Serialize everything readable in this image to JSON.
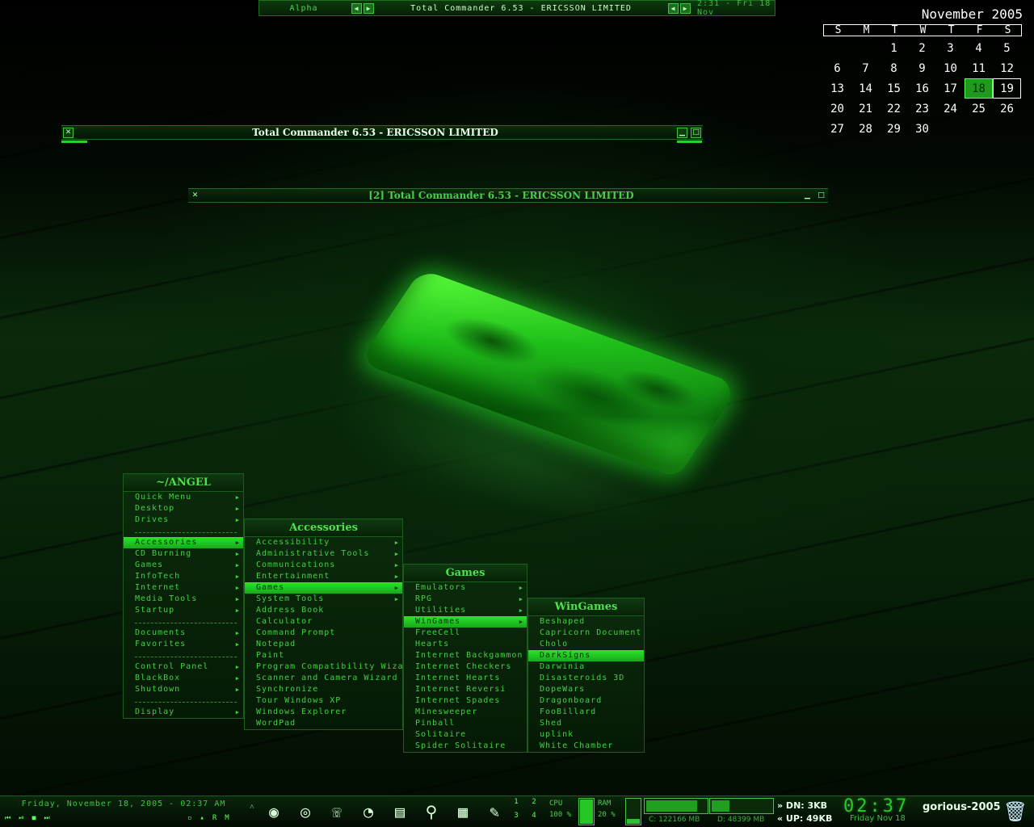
{
  "topbar": {
    "workspace": "Alpha",
    "title": "Total Commander 6.53 - ERICSSON LIMITED",
    "clock": "2:31 - Fri 18 Nov",
    "prev_icon": "arrow-left-icon",
    "next_icon": "arrow-right-icon"
  },
  "calendar": {
    "title": "November 2005",
    "weekdays": [
      "S",
      "M",
      "T",
      "W",
      "T",
      "F",
      "S"
    ],
    "days": [
      "",
      "",
      "1",
      "2",
      "3",
      "4",
      "5",
      "6",
      "7",
      "8",
      "9",
      "10",
      "11",
      "12",
      "13",
      "14",
      "15",
      "16",
      "17",
      "18",
      "19",
      "20",
      "21",
      "22",
      "23",
      "24",
      "25",
      "26",
      "27",
      "28",
      "29",
      "30"
    ],
    "today": "18",
    "selected": "19"
  },
  "windows": {
    "win1_title": "Total Commander 6.53 - ERICSSON LIMITED",
    "win2_title": "[2] Total Commander 6.53 - ERICSSON LIMITED"
  },
  "menus": {
    "main": {
      "title": "~/ANGEL",
      "items": [
        {
          "label": "Quick Menu",
          "sub": true
        },
        {
          "label": "Desktop",
          "sub": true
        },
        {
          "label": "Drives",
          "sub": true
        },
        {
          "sep": true
        },
        {
          "label": "Accessories",
          "sub": true,
          "hl": true
        },
        {
          "label": "CD Burning",
          "sub": true
        },
        {
          "label": "Games",
          "sub": true
        },
        {
          "label": "InfoTech",
          "sub": true
        },
        {
          "label": "Internet",
          "sub": true
        },
        {
          "label": "Media Tools",
          "sub": true
        },
        {
          "label": "Startup",
          "sub": true
        },
        {
          "sep": true
        },
        {
          "label": "Documents",
          "sub": true
        },
        {
          "label": "Favorites",
          "sub": true
        },
        {
          "sep": true
        },
        {
          "label": "Control Panel",
          "sub": true
        },
        {
          "label": "BlackBox",
          "sub": true
        },
        {
          "label": "Shutdown",
          "sub": true
        },
        {
          "sep": true
        },
        {
          "label": "Display",
          "sub": true
        }
      ]
    },
    "accessories": {
      "title": "Accessories",
      "items": [
        {
          "label": "Accessibility",
          "sub": true
        },
        {
          "label": "Administrative Tools",
          "sub": true
        },
        {
          "label": "Communications",
          "sub": true
        },
        {
          "label": "Entertainment",
          "sub": true
        },
        {
          "label": "Games",
          "sub": true,
          "hl": true
        },
        {
          "label": "System Tools",
          "sub": true
        },
        {
          "label": "Address Book"
        },
        {
          "label": "Calculator"
        },
        {
          "label": "Command Prompt"
        },
        {
          "label": "Notepad"
        },
        {
          "label": "Paint"
        },
        {
          "label": "Program Compatibility Wizard"
        },
        {
          "label": "Scanner and Camera Wizard"
        },
        {
          "label": "Synchronize"
        },
        {
          "label": "Tour Windows XP"
        },
        {
          "label": "Windows Explorer"
        },
        {
          "label": "WordPad"
        }
      ]
    },
    "games": {
      "title": "Games",
      "items": [
        {
          "label": "Emulators",
          "sub": true
        },
        {
          "label": "RPG",
          "sub": true
        },
        {
          "label": "Utilities",
          "sub": true
        },
        {
          "label": "WinGames",
          "sub": true,
          "hl": true
        },
        {
          "label": "FreeCell"
        },
        {
          "label": "Hearts"
        },
        {
          "label": "Internet Backgammon"
        },
        {
          "label": "Internet Checkers"
        },
        {
          "label": "Internet Hearts"
        },
        {
          "label": "Internet Reversi"
        },
        {
          "label": "Internet Spades"
        },
        {
          "label": "Minesweeper"
        },
        {
          "label": "Pinball"
        },
        {
          "label": "Solitaire"
        },
        {
          "label": "Spider Solitaire"
        }
      ]
    },
    "wingames": {
      "title": "WinGames",
      "items": [
        {
          "label": "Beshaped"
        },
        {
          "label": "Capricorn Document"
        },
        {
          "label": "Cholo"
        },
        {
          "label": "DarkSigns",
          "hl": true
        },
        {
          "label": "Darwinia"
        },
        {
          "label": "Disasteroids 3D"
        },
        {
          "label": "DopeWars"
        },
        {
          "label": "Dragonboard"
        },
        {
          "label": "FooBillard"
        },
        {
          "label": "Shed"
        },
        {
          "label": "uplink"
        },
        {
          "label": "White Chamber"
        }
      ]
    }
  },
  "taskbar": {
    "date": "Friday, November 18, 2005 - 02:37 AM",
    "player_controls": [
      "⏮",
      "⏯",
      "■",
      "⏭"
    ],
    "mini_controls": [
      "▫",
      "▴",
      "R",
      "M"
    ],
    "up_arrow": "˄",
    "icons": [
      "disc-icon",
      "cd-icon",
      "phone-icon",
      "pie-chart-icon",
      "books-icon",
      "magnifier-icon",
      "calendar-clock-icon",
      "notepad-icon"
    ],
    "icon_glyphs": [
      "◉",
      "◎",
      "☏",
      "◔",
      "▤",
      "⚲",
      "▦",
      "✎"
    ],
    "workspaces": [
      "1",
      "2",
      "3",
      "4"
    ],
    "cpu_label": "CPU",
    "cpu_value": "100 %",
    "cpu_fraction": 1.0,
    "ram_label": "RAM",
    "ram_value": "20 %",
    "ram_fraction": 0.2,
    "drive_c": "C: 122166 MB",
    "drive_c_fraction": 0.85,
    "drive_d": "D: 48399 MB",
    "drive_d_fraction": 0.3,
    "net_down": "» DN: 3KB",
    "net_up": "« UP: 49KB",
    "clock": "02:37",
    "clock_date": "Friday Nov 18",
    "logo": "gorious-2005",
    "trash_icon": "trash-icon"
  }
}
